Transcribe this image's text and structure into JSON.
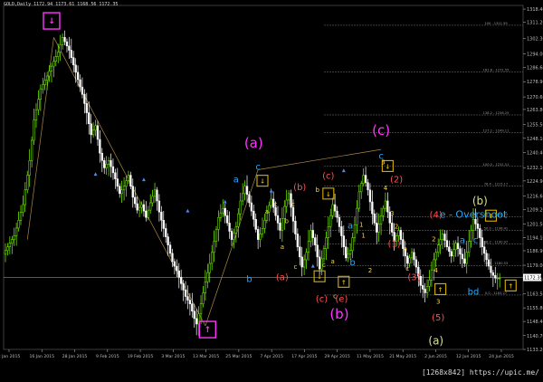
{
  "header": {
    "symbol_label": "GOLD,Daily  1172.94 1173.61 1168.56 1172.35"
  },
  "watermark": "[1268x842] https://upic.me/",
  "colors": {
    "background": "#000000",
    "bull": "#7cfc00",
    "bear": "#ffffff",
    "grid": "#3a3a3a",
    "magenta": "#ff33ff",
    "wave_c_small": "#22aaff",
    "wave_abc_yellow": "#ffd24d",
    "wave_red": "#ff5050",
    "wave_roman": "#ff66cc",
    "wave_b_khaki": "#d8e08a",
    "box_yellow": "#d8b000",
    "box_magenta": "#ff33ff",
    "fib_line": "#777777",
    "price_line": "#b0b0b0"
  },
  "chart_data": {
    "type": "candlestick",
    "title": "GOLD,Daily",
    "ylim": [
      1133.2,
      1320.4
    ],
    "y_ticks": [
      "1318.40",
      "1311.20",
      "1302.30",
      "1294.00",
      "1286.60",
      "1278.90",
      "1270.60",
      "1263.80",
      "1255.50",
      "1248.10",
      "1240.40",
      "1232.10",
      "1224.90",
      "1216.60",
      "1209.20",
      "1201.50",
      "1194.10",
      "1186.90",
      "1179.00",
      "1171.30",
      "1163.50",
      "1155.80",
      "1148.40",
      "1140.70",
      "1133.20"
    ],
    "x_ticks": [
      "2 Jan 2015",
      "16 Jan 2015",
      "28 Jan 2015",
      "9 Feb 2015",
      "19 Feb 2015",
      "3 Mar 2015",
      "13 Mar 2015",
      "25 Mar 2015",
      "7 Apr 2015",
      "17 Apr 2015",
      "29 Apr 2015",
      "11 May 2015",
      "21 May 2015",
      "2 Jun 2015",
      "12 Jun 2015",
      "24 Jun 2015"
    ],
    "last_price": "1172.35",
    "fib_levels": [
      {
        "label": "100 - 1311.59",
        "value": 1309.6
      },
      {
        "label": "161.8 - 1271.55",
        "value": 1284.2
      },
      {
        "label": "138.2 - 1256.25",
        "value": 1260.8
      },
      {
        "label": "127.2 - 1249.11",
        "value": 1251.1
      },
      {
        "label": "100.0 - 1231.51",
        "value": 1232.8
      },
      {
        "label": "76.4 - 1215.17",
        "value": 1222.2
      },
      {
        "label": "61.8 - 1206.27",
        "value": 1205.3
      },
      {
        "label": "50.0 - 1198.41",
        "value": 1198.1
      },
      {
        "label": "38.2 - 1190.97",
        "value": 1190.6
      },
      {
        "label": "23.6 - 1180.53",
        "value": 1178.9
      },
      {
        "label": "0.0 - 1163.27",
        "value": 1162.8
      }
    ],
    "series_points": [
      [
        0,
        1185
      ],
      [
        5,
        1195
      ],
      [
        9,
        1212
      ],
      [
        12,
        1236
      ],
      [
        14,
        1258
      ],
      [
        17,
        1275
      ],
      [
        20,
        1282
      ],
      [
        23,
        1290
      ],
      [
        25,
        1295
      ],
      [
        27,
        1303
      ],
      [
        30,
        1296
      ],
      [
        33,
        1284
      ],
      [
        36,
        1272
      ],
      [
        38,
        1262
      ],
      [
        40,
        1250
      ],
      [
        42,
        1255
      ],
      [
        44,
        1240
      ],
      [
        46,
        1232
      ],
      [
        48,
        1236
      ],
      [
        51,
        1226
      ],
      [
        53,
        1218
      ],
      [
        55,
        1222
      ],
      [
        57,
        1228
      ],
      [
        59,
        1216
      ],
      [
        61,
        1209
      ],
      [
        63,
        1212
      ],
      [
        65,
        1205
      ],
      [
        67,
        1213
      ],
      [
        69,
        1220
      ],
      [
        71,
        1208
      ],
      [
        73,
        1199
      ],
      [
        75,
        1190
      ],
      [
        77,
        1181
      ],
      [
        79,
        1176
      ],
      [
        81,
        1169
      ],
      [
        83,
        1162
      ],
      [
        85,
        1158
      ],
      [
        87,
        1150
      ],
      [
        88,
        1147
      ],
      [
        90,
        1158
      ],
      [
        92,
        1170
      ],
      [
        94,
        1180
      ],
      [
        96,
        1192
      ],
      [
        98,
        1205
      ],
      [
        100,
        1210
      ],
      [
        102,
        1202
      ],
      [
        104,
        1193
      ],
      [
        106,
        1200
      ],
      [
        108,
        1214
      ],
      [
        110,
        1222
      ],
      [
        112,
        1213
      ],
      [
        114,
        1204
      ],
      [
        116,
        1193
      ],
      [
        118,
        1199
      ],
      [
        120,
        1208
      ],
      [
        122,
        1215
      ],
      [
        124,
        1206
      ],
      [
        126,
        1198
      ],
      [
        128,
        1211
      ],
      [
        130,
        1218
      ],
      [
        132,
        1203
      ],
      [
        134,
        1189
      ],
      [
        136,
        1178
      ],
      [
        138,
        1186
      ],
      [
        140,
        1198
      ],
      [
        142,
        1190
      ],
      [
        144,
        1177
      ],
      [
        146,
        1188
      ],
      [
        148,
        1200
      ],
      [
        150,
        1212
      ],
      [
        152,
        1205
      ],
      [
        154,
        1195
      ],
      [
        156,
        1183
      ],
      [
        158,
        1187
      ],
      [
        160,
        1201
      ],
      [
        162,
        1219
      ],
      [
        164,
        1228
      ],
      [
        166,
        1220
      ],
      [
        168,
        1207
      ],
      [
        170,
        1197
      ],
      [
        172,
        1206
      ],
      [
        174,
        1214
      ],
      [
        176,
        1202
      ],
      [
        178,
        1192
      ],
      [
        180,
        1198
      ],
      [
        182,
        1188
      ],
      [
        184,
        1180
      ],
      [
        186,
        1186
      ],
      [
        188,
        1178
      ],
      [
        190,
        1168
      ],
      [
        192,
        1164
      ],
      [
        194,
        1171
      ],
      [
        196,
        1182
      ],
      [
        198,
        1190
      ],
      [
        200,
        1196
      ],
      [
        202,
        1189
      ],
      [
        204,
        1184
      ],
      [
        206,
        1191
      ],
      [
        208,
        1185
      ],
      [
        210,
        1180
      ],
      [
        212,
        1192
      ],
      [
        214,
        1204
      ],
      [
        216,
        1199
      ],
      [
        218,
        1189
      ],
      [
        220,
        1182
      ],
      [
        222,
        1175
      ],
      [
        224,
        1172
      ]
    ],
    "annotations": [
      {
        "text": "(a)",
        "color": "magenta",
        "size": "large",
        "date_index": 113,
        "price": 1243
      },
      {
        "text": "(c)",
        "color": "magenta",
        "size": "large",
        "date_index": 171,
        "price": 1250
      },
      {
        "text": "(b)",
        "color": "magenta",
        "size": "large",
        "date_index": 152,
        "price": 1150
      },
      {
        "text": "c",
        "color": "blue",
        "date_index": 115,
        "price": 1231
      },
      {
        "text": "a",
        "color": "blue",
        "date_index": 105,
        "price": 1224
      },
      {
        "text": "b",
        "color": "blue",
        "date_index": 111,
        "price": 1170
      },
      {
        "text": "c",
        "color": "blue",
        "date_index": 171,
        "price": 1237
      },
      {
        "text": "a",
        "color": "blue",
        "date_index": 157,
        "price": 1199
      },
      {
        "text": "b",
        "color": "blue",
        "date_index": 158,
        "price": 1179
      },
      {
        "text": "a",
        "color": "blue",
        "date_index": 208,
        "price": 1191
      },
      {
        "text": "c",
        "color": "blue",
        "date_index": 214,
        "price": 1191
      },
      {
        "text": "bd",
        "color": "blue",
        "date_index": 213,
        "price": 1163
      },
      {
        "text": "(a)",
        "color": "red",
        "date_index": 126,
        "price": 1171
      },
      {
        "text": "(b)",
        "color": "red",
        "date_index": 134,
        "price": 1220
      },
      {
        "text": "(c)",
        "color": "red",
        "date_index": 147,
        "price": 1226
      },
      {
        "text": "(c)",
        "color": "red",
        "date_index": 144,
        "price": 1159
      },
      {
        "text": "(e)",
        "color": "red",
        "date_index": 153,
        "price": 1159
      },
      {
        "text": "(2)",
        "color": "red",
        "date_index": 178,
        "price": 1224
      },
      {
        "text": "(4)",
        "color": "red",
        "date_index": 196,
        "price": 1205
      },
      {
        "text": "(1)",
        "color": "red",
        "date_index": 177,
        "price": 1189
      },
      {
        "text": "(3)",
        "color": "red",
        "date_index": 186,
        "price": 1171
      },
      {
        "text": "(5)",
        "color": "red",
        "date_index": 197,
        "price": 1149
      },
      {
        "text": "e - Overshoot",
        "color": "blue",
        "date_index": 213,
        "price": 1205
      },
      {
        "text": "(b)",
        "color": "khaki",
        "date_index": 216,
        "price": 1212
      },
      {
        "text": "(a)",
        "color": "khaki",
        "date_index": 196,
        "price": 1136
      }
    ],
    "boxes": [
      {
        "kind": "magenta",
        "date_index": 21,
        "price": 1312,
        "arrow": "down"
      },
      {
        "kind": "magenta",
        "date_index": 92,
        "price": 1144,
        "arrow": "up"
      },
      {
        "kind": "yellow",
        "date_index": 117,
        "price": 1225,
        "arrow": "down"
      },
      {
        "kind": "yellow",
        "date_index": 147,
        "price": 1218,
        "arrow": "down"
      },
      {
        "kind": "yellow",
        "date_index": 143,
        "price": 1173,
        "arrow": "down"
      },
      {
        "kind": "yellow",
        "date_index": 154,
        "price": 1170,
        "arrow": "up"
      },
      {
        "kind": "yellow",
        "date_index": 174,
        "price": 1233,
        "arrow": "down"
      },
      {
        "kind": "yellow",
        "date_index": 198,
        "price": 1166,
        "arrow": "up"
      },
      {
        "kind": "yellow",
        "date_index": 221,
        "price": 1206,
        "arrow": "down"
      },
      {
        "kind": "yellow",
        "date_index": 230,
        "price": 1168,
        "arrow": "up"
      }
    ]
  }
}
